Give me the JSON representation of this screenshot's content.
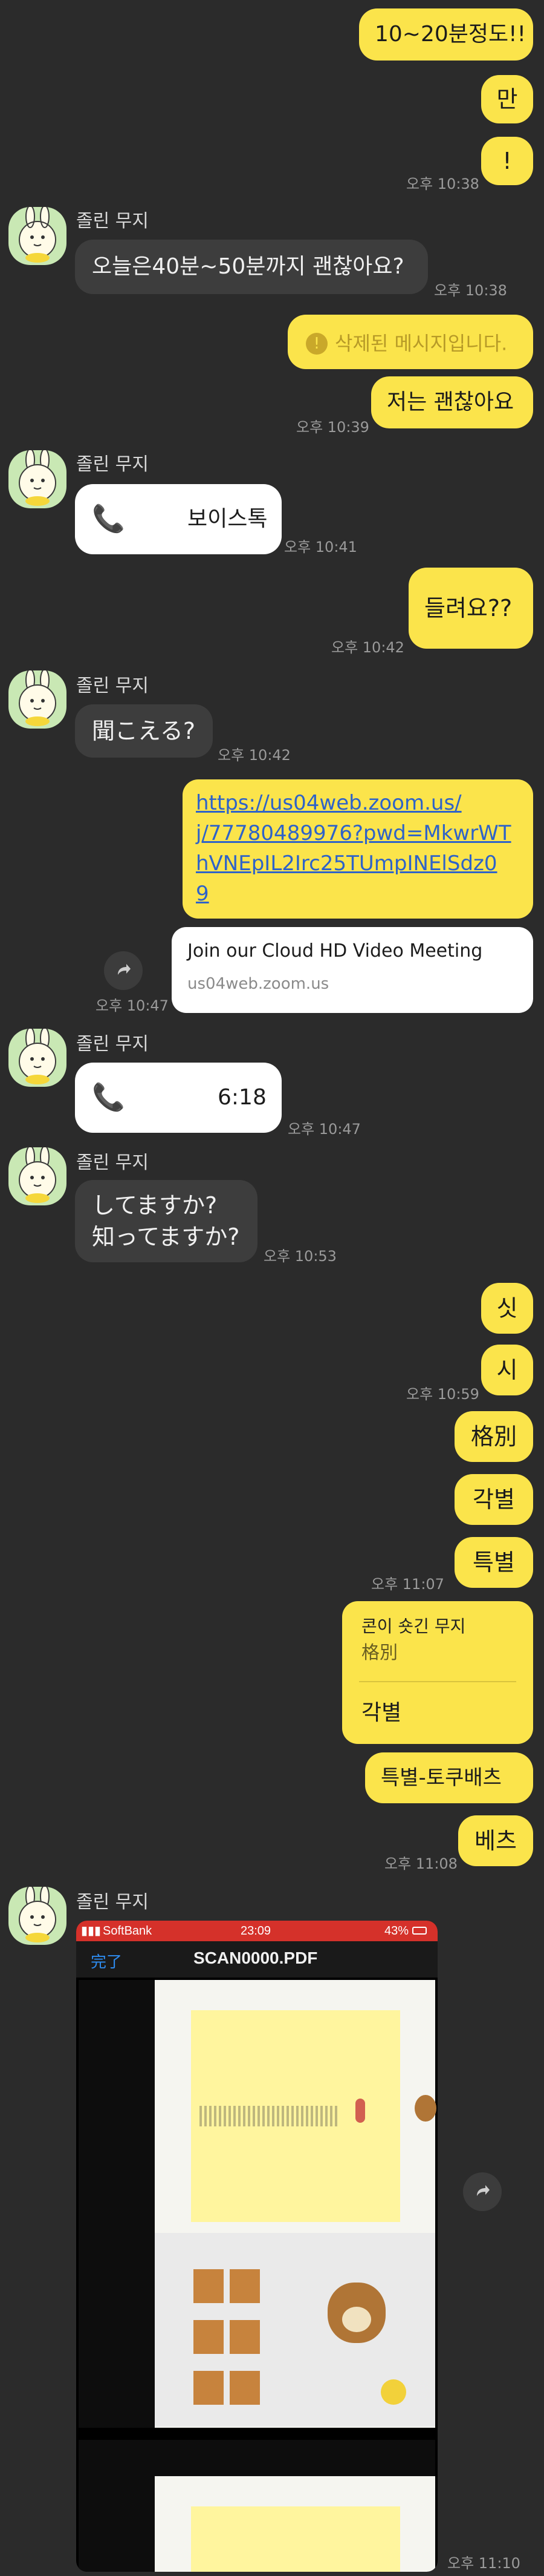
{
  "colors": {
    "background": "#2b2b2b",
    "my_bubble": "#fbe44b",
    "their_bubble": "#3d3d3d",
    "call_bubble": "#ffffff",
    "timestamp": "#9a9a9a"
  },
  "contact": {
    "name": "졸린 무지"
  },
  "messages": {
    "m1": "10~20분정도!!",
    "m2": "만",
    "m3": "!",
    "t1": "오후 10:38",
    "m4": "오늘은40분~50분까지 괜찮아요?",
    "t2": "오후 10:38",
    "m5": "삭제된 메시지입니다.",
    "m6": "저는 괜찮아요",
    "t3": "오후 10:39",
    "m7": "보이스톡",
    "t4": "오후 10:41",
    "m8": "들려요??",
    "t5": "오후 10:42",
    "m9": "聞こえる?",
    "t6": "오후 10:42",
    "m10_link": "https://us04web.zoom.us/j/77780489976?pwd=MkwrWThVNEpIL2Irc25TUmpINElSdz09",
    "m10_lines": [
      "https://us04web.zoom.us/",
      "j/77780489976?pwd=MkwrWT",
      "hVNEpIL2Irc25TUmpINElSdz0",
      "9"
    ],
    "preview_title": "Join our Cloud HD Video Meeting",
    "preview_domain": "us04web.zoom.us",
    "t7": "오후 10:47",
    "m11": "6:18",
    "t8": "오후 10:47",
    "m12_line1": "してますか?",
    "m12_line2": "知ってますか?",
    "t9": "오후 10:53",
    "m13": "싯",
    "m14": "시",
    "t10": "오후 10:59",
    "m15": "格別",
    "m16": "각별",
    "m17": "특별",
    "t11": "오후 11:07",
    "reply_to": "콘이 숏긴 무지",
    "reply_quote": "格別",
    "m18": "각별",
    "m19": "특별-토쿠배츠",
    "m20": "베츠",
    "t12": "오후 11:08",
    "t13": "오후 11:10"
  },
  "phone": {
    "carrier": "SoftBank",
    "time": "23:09",
    "battery": "43%",
    "done": "完了",
    "file": "SCAN0000.PDF"
  },
  "icons": [
    "phone-icon",
    "share-icon",
    "info-icon",
    "avatar-muzi"
  ]
}
